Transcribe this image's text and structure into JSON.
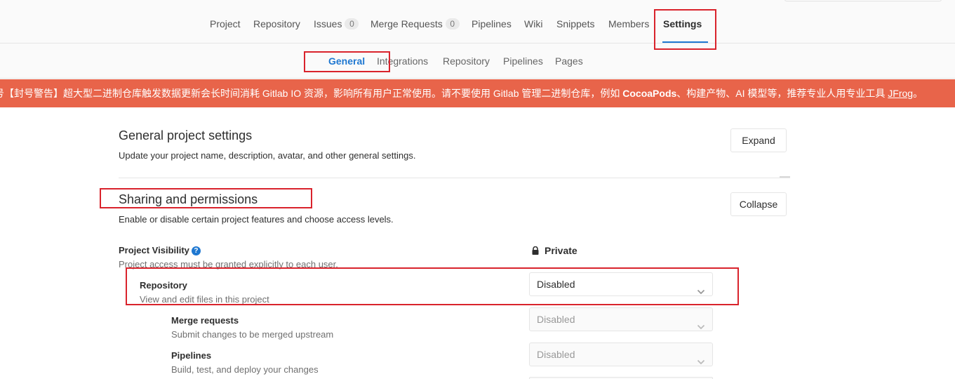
{
  "top_nav": {
    "tabs": [
      {
        "label": "Project"
      },
      {
        "label": "Repository"
      },
      {
        "label": "Issues",
        "count": "0"
      },
      {
        "label": "Merge Requests",
        "count": "0"
      },
      {
        "label": "Pipelines"
      },
      {
        "label": "Wiki"
      },
      {
        "label": "Snippets"
      },
      {
        "label": "Members"
      },
      {
        "label": "Settings",
        "active": true
      }
    ]
  },
  "sub_nav": {
    "tabs": [
      {
        "label": "General",
        "active": true
      },
      {
        "label": "Integrations"
      },
      {
        "label": "Repository"
      },
      {
        "label": "Pipelines"
      },
      {
        "label": "Pages"
      }
    ]
  },
  "banner": {
    "prefix": "号【封号警告】超大型二进制仓库触发数据更新会长时间消耗 Gitlab IO 资源，影响所有用户正常使用。请不要使用 Gitlab 管理二进制仓库，例如 ",
    "bold_1": "CocoaPods",
    "middle": "、构建产物、AI 模型等，推荐专业人用专业工具 ",
    "link": "JFrog",
    "suffix": "。",
    "background_color": "#e8644a"
  },
  "general_section": {
    "title": "General project settings",
    "description": "Update your project name, description, avatar, and other general settings.",
    "button": "Expand"
  },
  "sharing_section": {
    "title": "Sharing and permissions",
    "description": "Enable or disable certain project features and choose access levels.",
    "button": "Collapse",
    "visibility": {
      "label": "Project Visibility",
      "help_icon": "question-circle-icon",
      "sublabel": "Project access must be granted explicitly to each user.",
      "value": "Private",
      "value_icon": "lock-icon"
    },
    "features": [
      {
        "label": "Repository",
        "sublabel": "View and edit files in this project",
        "value": "Disabled",
        "enabled": true
      },
      {
        "label": "Merge requests",
        "sublabel": "Submit changes to be merged upstream",
        "value": "Disabled",
        "enabled": false
      },
      {
        "label": "Pipelines",
        "sublabel": "Build, test, and deploy your changes",
        "value": "Disabled",
        "enabled": false
      }
    ]
  },
  "colors": {
    "accent": "#1f78d1",
    "highlight_box": "#d9232c"
  }
}
